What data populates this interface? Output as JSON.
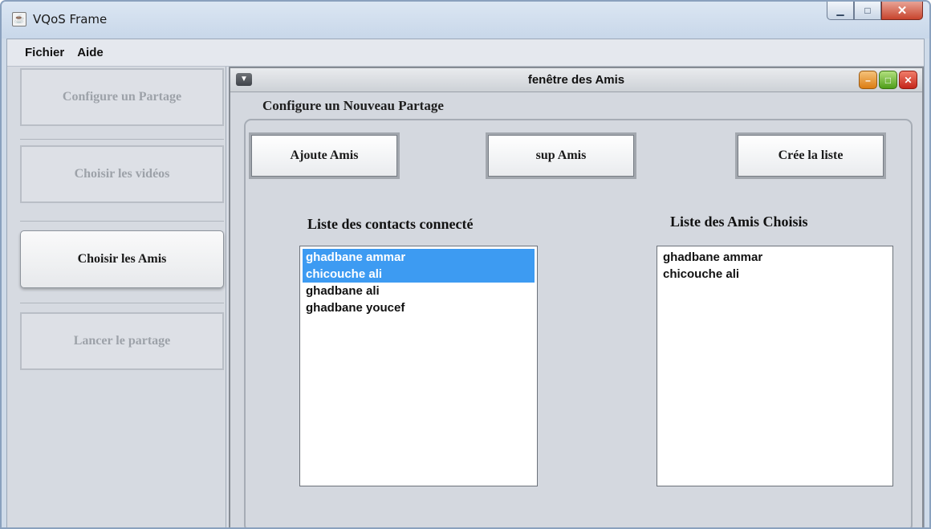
{
  "window": {
    "title": "VQoS Frame",
    "icon": "java-icon",
    "controls": {
      "minimize": "▁",
      "maximize": "□",
      "close": "✕"
    }
  },
  "menubar": [
    "Fichier",
    "Aide"
  ],
  "sidebar": {
    "items": [
      {
        "label": "Configure un Partage",
        "state": "disabled"
      },
      {
        "label": "Choisir les vidéos",
        "state": "disabled"
      },
      {
        "label": "Choisir les Amis",
        "state": "active"
      },
      {
        "label": "Lancer le partage",
        "state": "disabled"
      }
    ]
  },
  "internal_frame": {
    "title": "fenêtre des Amis",
    "section_title": "Configure un Nouveau Partage",
    "buttons": {
      "add": "Ajoute  Amis",
      "remove": "sup Amis",
      "create": "Crée la liste"
    },
    "connected_list": {
      "label": "Liste des contacts connecté",
      "items": [
        {
          "text": "ghadbane ammar",
          "selected": true
        },
        {
          "text": "chicouche ali",
          "selected": true
        },
        {
          "text": "ghadbane ali",
          "selected": false
        },
        {
          "text": "ghadbane youcef",
          "selected": false
        }
      ]
    },
    "chosen_list": {
      "label": "Liste des Amis Choisis",
      "items": [
        {
          "text": "ghadbane ammar",
          "selected": false
        },
        {
          "text": "chicouche ali",
          "selected": false
        }
      ]
    }
  },
  "colors": {
    "selection": "#3d9bf2",
    "close_red": "#c5261a"
  }
}
